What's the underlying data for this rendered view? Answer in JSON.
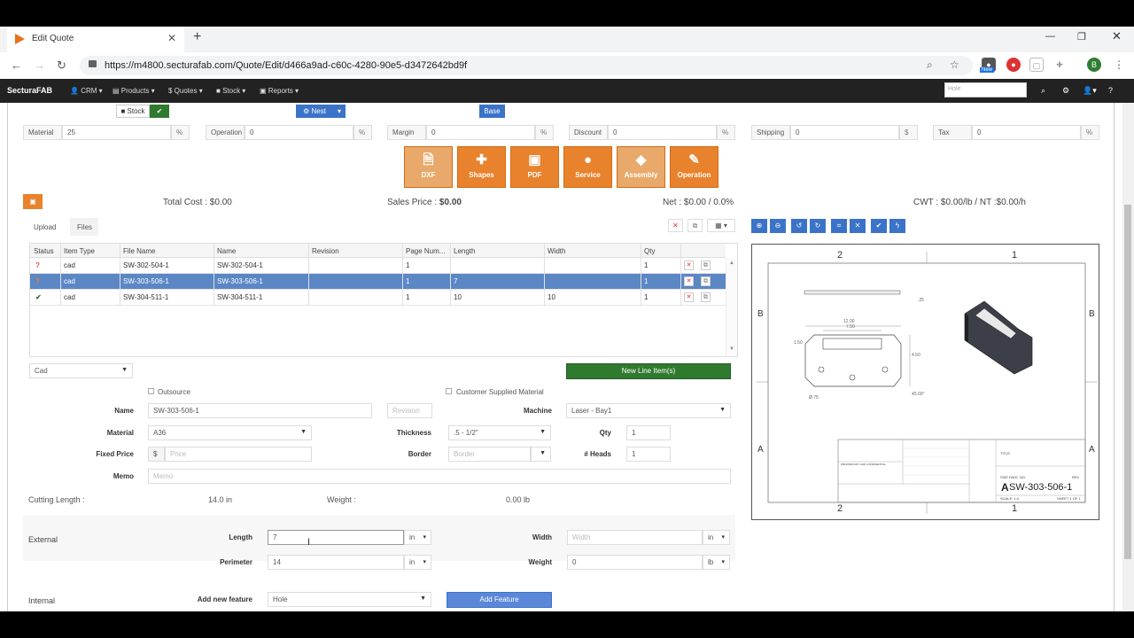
{
  "browser": {
    "tab_title": "Edit Quote",
    "url": "https://m4800.secturafab.com/Quote/Edit/d466a9ad-c60c-4280-90e5-d3472642bd9f",
    "ext_badge": "New",
    "profile_initial": "B"
  },
  "app": {
    "brand_pre": "Sectura",
    "brand_post": "FAB",
    "menu": [
      "CRM",
      "Products",
      "$ Quotes",
      "Stock",
      "Reports"
    ],
    "search_placeholder": "Hole"
  },
  "top": {
    "stock_label": "Stock",
    "nest_label": "Nest",
    "base_label": "Base"
  },
  "rates": [
    {
      "label": "Material",
      "value": "25",
      "unit": "%"
    },
    {
      "label": "Operation",
      "value": "0",
      "unit": "%"
    },
    {
      "label": "Margin",
      "value": "0",
      "unit": "%"
    },
    {
      "label": "Discount",
      "value": "0",
      "unit": "%"
    },
    {
      "label": "Shipping",
      "value": "0",
      "unit": "$"
    },
    {
      "label": "Tax",
      "value": "0",
      "unit": "%"
    }
  ],
  "tiles": [
    {
      "label": "DXF",
      "icon": "file-icon"
    },
    {
      "label": "Shapes",
      "icon": "puzzle-icon"
    },
    {
      "label": "PDF",
      "icon": "image-icon"
    },
    {
      "label": "Service",
      "icon": "user-icon"
    },
    {
      "label": "Assembly",
      "icon": "tags-icon"
    },
    {
      "label": "Operation",
      "icon": "wrench-icon"
    }
  ],
  "summary": {
    "total_cost": "Total Cost : $0.00",
    "sales_label": "Sales Price : ",
    "sales_value": "$0.00",
    "net": "Net : $0.00 / 0.0%",
    "cwt": "CWT : $0.00/lb / NT :$0.00/h"
  },
  "subtabs": [
    "Upload",
    "Files"
  ],
  "table": {
    "headers": [
      "Status",
      "Item Type",
      "File Name",
      "Name",
      "Revision",
      "Page Num...",
      "Length",
      "Width",
      "Qty"
    ],
    "rows": [
      {
        "status": "?",
        "type": "cad",
        "file": "SW-302-504-1",
        "name": "SW-302-504-1",
        "rev": "",
        "page": "1",
        "length": "",
        "width": "",
        "qty": "1"
      },
      {
        "status": "?",
        "type": "cad",
        "file": "SW-303-506-1",
        "name": "SW-303-506-1",
        "rev": "",
        "page": "1",
        "length": "7",
        "width": "",
        "qty": "1"
      },
      {
        "status": "✔",
        "type": "cad",
        "file": "SW-304-511-1",
        "name": "SW-304-511-1",
        "rev": "",
        "page": "1",
        "length": "10",
        "width": "10",
        "qty": "1"
      }
    ]
  },
  "form": {
    "item_type": "Cad",
    "new_line": "New Line Item(s)",
    "outsource": "Outsource",
    "customer_material": "Customer Supplied Material",
    "name_label": "Name",
    "name_value": "SW-303-506-1",
    "revision_ph": "Revision",
    "machine_label": "Machine",
    "machine_value": "Laser - Bay1",
    "material_label": "Material",
    "material_value": "A36",
    "thickness_label": "Thickness",
    "thickness_value": ".5 - 1/2\"",
    "qty_label": "Qty",
    "qty_value": "1",
    "fixed_label": "Fixed Price",
    "currency": "$",
    "price_ph": "Price",
    "border_label": "Border",
    "border_ph": "Border",
    "heads_label": "# Heads",
    "heads_value": "1",
    "memo_label": "Memo",
    "memo_ph": "Memo",
    "cutting_label": "Cutting Length :",
    "cutting_value": "14.0 in",
    "weight_label": "Weight :",
    "weight_value": "0.00 lb",
    "external": "External",
    "length_label": "Length",
    "length_value": "7",
    "width_label": "Width",
    "width_ph": "Width",
    "unit_in": "in",
    "perimeter_label": "Perimeter",
    "perimeter_value": "14",
    "weight2_label": "Weight",
    "weight2_value": "0",
    "unit_lb": "lb",
    "internal": "Internal",
    "add_feature_label": "Add new feature",
    "feature_value": "Hole",
    "add_feature_btn": "Add Feature"
  },
  "drawing": {
    "title": "SW-303-506-1",
    "title_prefix": "A",
    "cols": [
      "2",
      "1"
    ],
    "rows": [
      "B",
      "A"
    ],
    "dims": [
      "12.00",
      "7.50",
      "1.50",
      "4.50",
      "Ø.75",
      "45.00°",
      ".25"
    ],
    "scale": "SCALE: 1:4",
    "sheet": "SHEET 1 OF 1",
    "size": "SIZE  DWG. NO.",
    "rev": "REV",
    "title_label": "TITLE:",
    "notes_title": "PROPRIETARY AND CONFIDENTIAL"
  },
  "colors": {
    "accent": "#e8822c",
    "blue": "#3b73c8",
    "green": "#2f7a2f",
    "select": "#5b87c5"
  }
}
